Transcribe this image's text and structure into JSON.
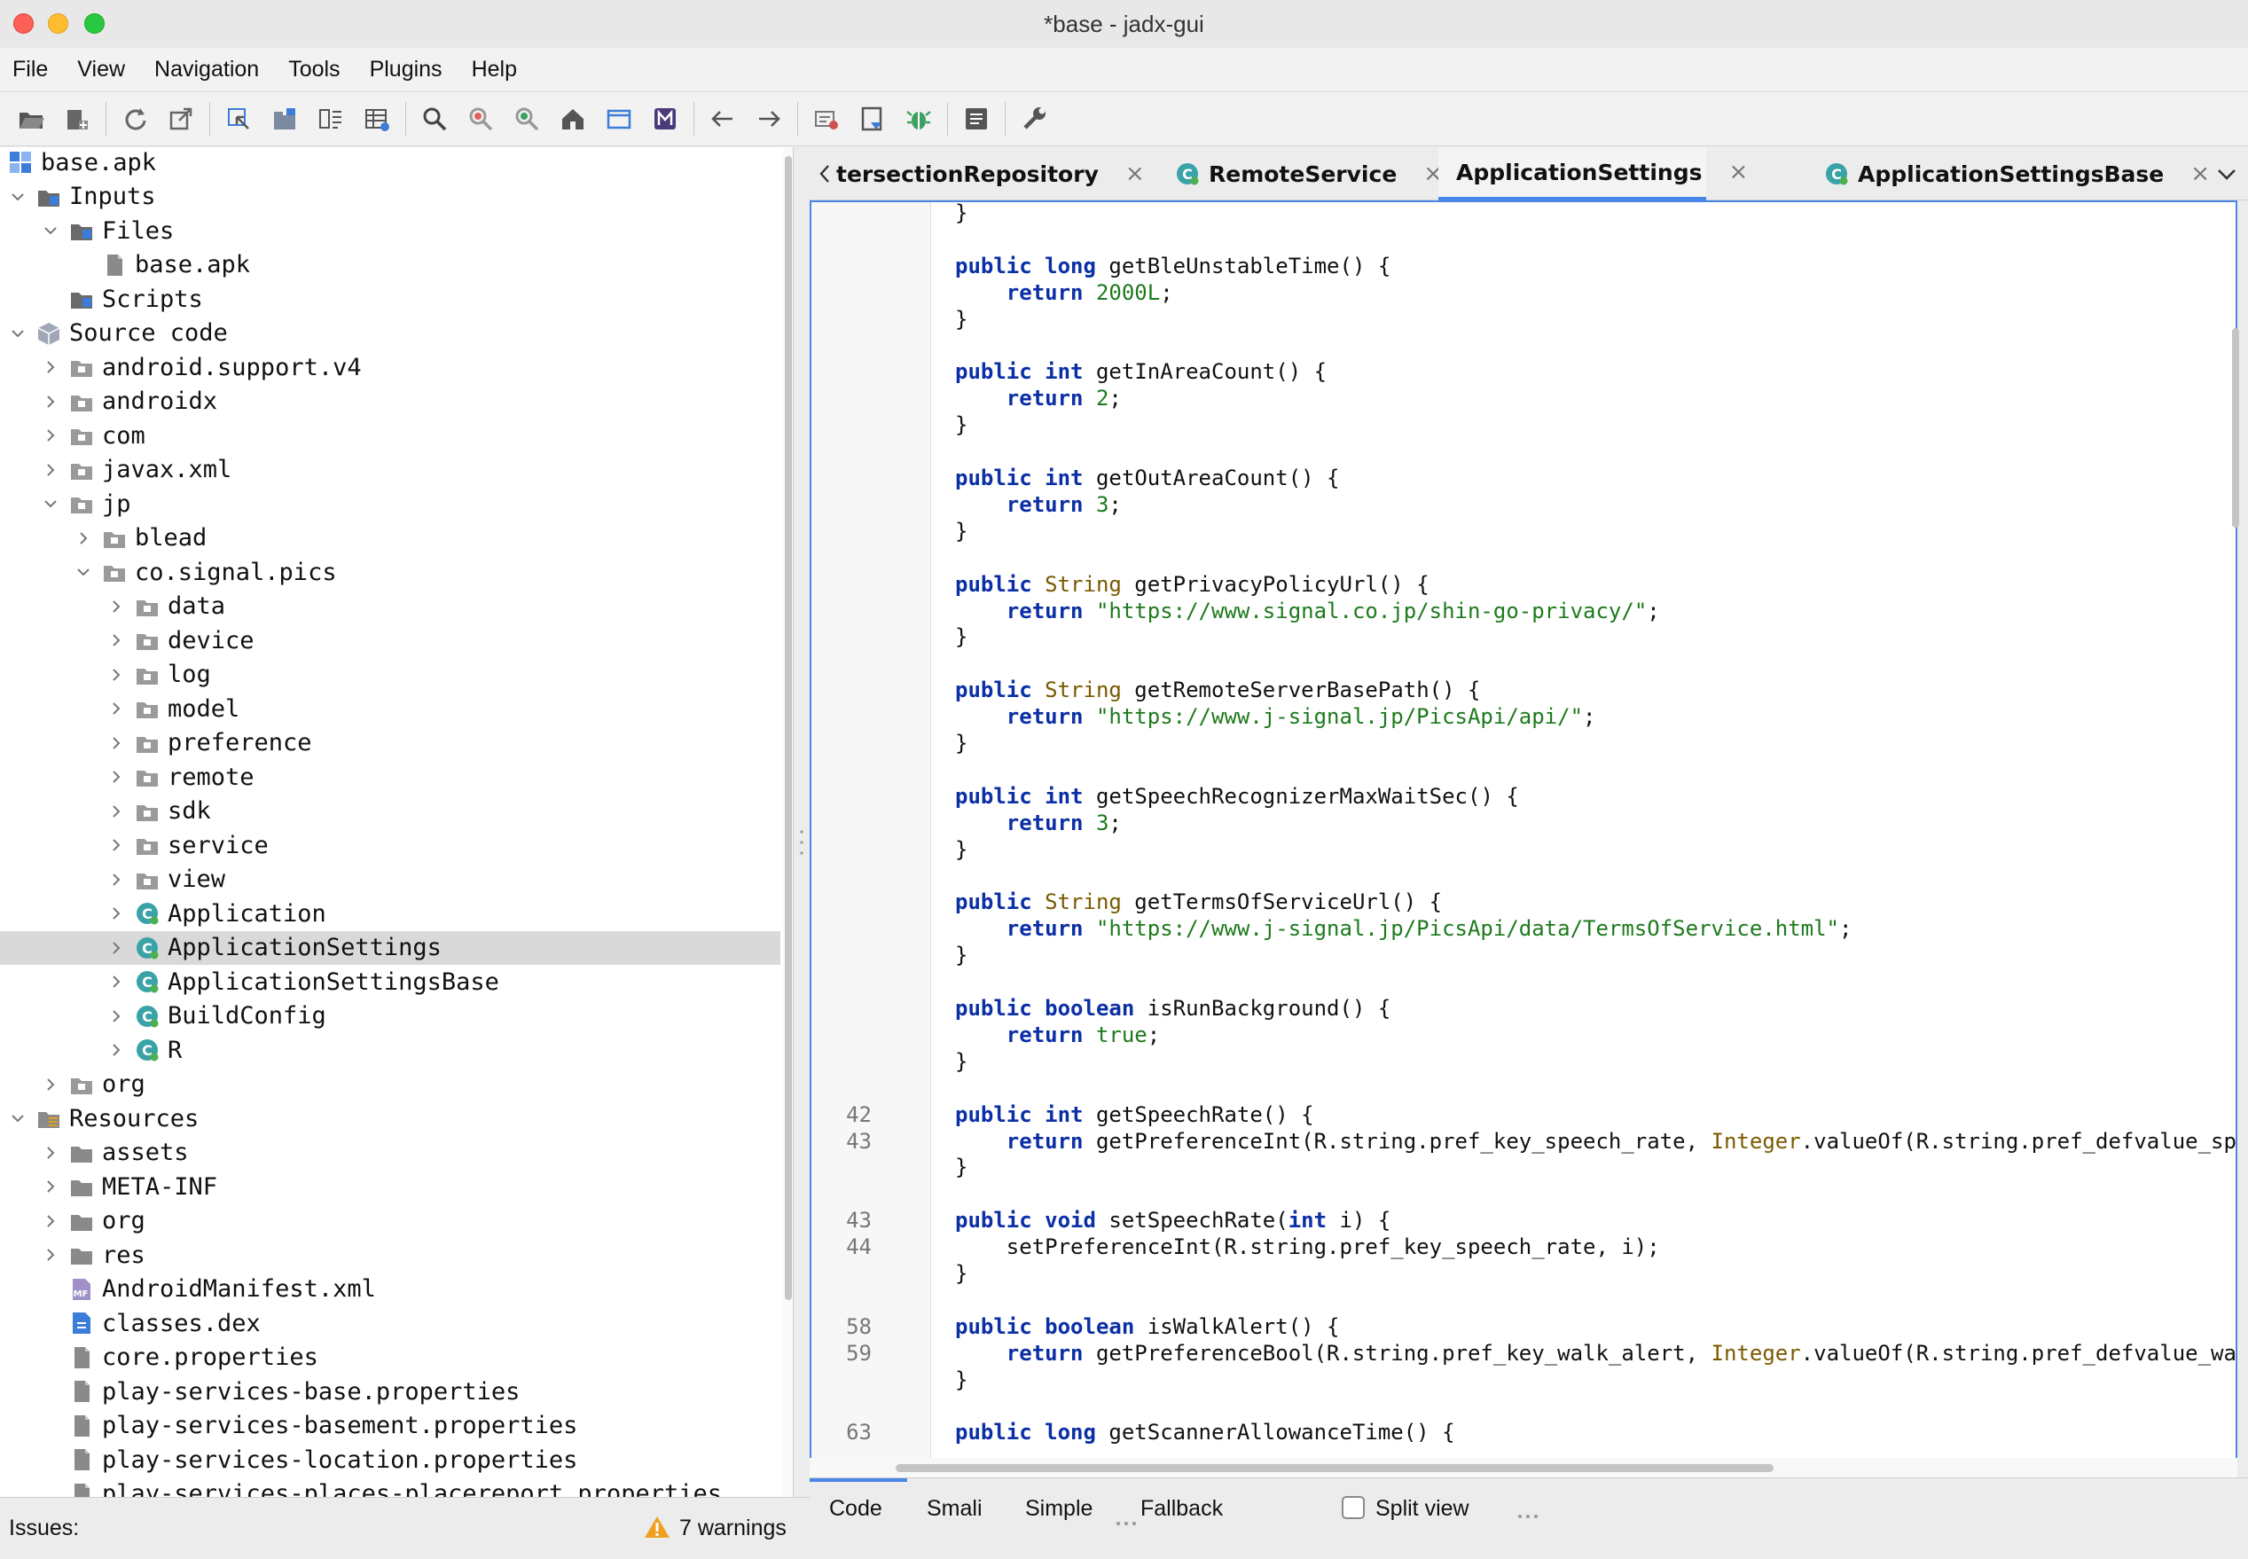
{
  "window": {
    "title": "*base - jadx-gui"
  },
  "menu": [
    "File",
    "View",
    "Navigation",
    "Tools",
    "Plugins",
    "Help"
  ],
  "toolbar": {
    "icons": [
      "open-file-icon",
      "add-files-icon",
      "reload-icon",
      "export-icon",
      "sync-tree-icon",
      "flatten-packages-icon",
      "quark-icon",
      "table-icon",
      "search-icon",
      "find-usage-icon",
      "search-text-icon",
      "home-icon",
      "window-icon",
      "mapping-icon",
      "back-icon",
      "forward-icon",
      "deobfuscate-icon",
      "bookmark-icon",
      "debug-icon",
      "log-icon",
      "settings-icon"
    ]
  },
  "tree": [
    {
      "label": "base.apk",
      "depth": 0,
      "chevron": "none",
      "icon": "apk"
    },
    {
      "label": "Inputs",
      "depth": 0,
      "chevron": "down",
      "icon": "folder-dark"
    },
    {
      "label": "Files",
      "depth": 1,
      "chevron": "down",
      "icon": "folder-dark"
    },
    {
      "label": "base.apk",
      "depth": 2,
      "chevron": "none",
      "icon": "file"
    },
    {
      "label": "Scripts",
      "depth": 1,
      "chevron": "none",
      "icon": "folder-dark"
    },
    {
      "label": "Source code",
      "depth": 0,
      "chevron": "down",
      "icon": "box"
    },
    {
      "label": "android.support.v4",
      "depth": 1,
      "chevron": "right",
      "icon": "package"
    },
    {
      "label": "androidx",
      "depth": 1,
      "chevron": "right",
      "icon": "package"
    },
    {
      "label": "com",
      "depth": 1,
      "chevron": "right",
      "icon": "package"
    },
    {
      "label": "javax.xml",
      "depth": 1,
      "chevron": "right",
      "icon": "package"
    },
    {
      "label": "jp",
      "depth": 1,
      "chevron": "down",
      "icon": "package"
    },
    {
      "label": "blead",
      "depth": 2,
      "chevron": "right",
      "icon": "package"
    },
    {
      "label": "co.signal.pics",
      "depth": 2,
      "chevron": "down",
      "icon": "package"
    },
    {
      "label": "data",
      "depth": 3,
      "chevron": "right",
      "icon": "package"
    },
    {
      "label": "device",
      "depth": 3,
      "chevron": "right",
      "icon": "package"
    },
    {
      "label": "log",
      "depth": 3,
      "chevron": "right",
      "icon": "package"
    },
    {
      "label": "model",
      "depth": 3,
      "chevron": "right",
      "icon": "package"
    },
    {
      "label": "preference",
      "depth": 3,
      "chevron": "right",
      "icon": "package"
    },
    {
      "label": "remote",
      "depth": 3,
      "chevron": "right",
      "icon": "package"
    },
    {
      "label": "sdk",
      "depth": 3,
      "chevron": "right",
      "icon": "package"
    },
    {
      "label": "service",
      "depth": 3,
      "chevron": "right",
      "icon": "package"
    },
    {
      "label": "view",
      "depth": 3,
      "chevron": "right",
      "icon": "package"
    },
    {
      "label": "Application",
      "depth": 3,
      "chevron": "right",
      "icon": "class"
    },
    {
      "label": "ApplicationSettings",
      "depth": 3,
      "chevron": "right",
      "icon": "class",
      "selected": true
    },
    {
      "label": "ApplicationSettingsBase",
      "depth": 3,
      "chevron": "right",
      "icon": "class"
    },
    {
      "label": "BuildConfig",
      "depth": 3,
      "chevron": "right",
      "icon": "class"
    },
    {
      "label": "R",
      "depth": 3,
      "chevron": "right",
      "icon": "class"
    },
    {
      "label": "org",
      "depth": 1,
      "chevron": "right",
      "icon": "package"
    },
    {
      "label": "Resources",
      "depth": 0,
      "chevron": "down",
      "icon": "resources"
    },
    {
      "label": "assets",
      "depth": 1,
      "chevron": "right",
      "icon": "folder"
    },
    {
      "label": "META-INF",
      "depth": 1,
      "chevron": "right",
      "icon": "folder"
    },
    {
      "label": "org",
      "depth": 1,
      "chevron": "right",
      "icon": "folder"
    },
    {
      "label": "res",
      "depth": 1,
      "chevron": "right",
      "icon": "folder"
    },
    {
      "label": "AndroidManifest.xml",
      "depth": 1,
      "chevron": "none",
      "icon": "manifest"
    },
    {
      "label": "classes.dex",
      "depth": 1,
      "chevron": "none",
      "icon": "dex"
    },
    {
      "label": "core.properties",
      "depth": 1,
      "chevron": "none",
      "icon": "file"
    },
    {
      "label": "play-services-base.properties",
      "depth": 1,
      "chevron": "none",
      "icon": "file"
    },
    {
      "label": "play-services-basement.properties",
      "depth": 1,
      "chevron": "none",
      "icon": "file"
    },
    {
      "label": "play-services-location.properties",
      "depth": 1,
      "chevron": "none",
      "icon": "file"
    },
    {
      "label": "play-services-places-placereport.properties",
      "depth": 1,
      "chevron": "none",
      "icon": "file"
    }
  ],
  "tabs": [
    {
      "label": "tersectionRepository",
      "icon": false,
      "active": false
    },
    {
      "label": "RemoteService",
      "icon": true,
      "active": false
    },
    {
      "label": "ApplicationSettings",
      "icon": true,
      "active": true
    },
    {
      "label": "ApplicationSettingsBase",
      "icon": true,
      "active": false
    }
  ],
  "tab_close_glyph": "×",
  "code": [
    {
      "ln": "",
      "tokens": [
        [
          "p",
          "}"
        ]
      ]
    },
    {
      "ln": "",
      "tokens": []
    },
    {
      "ln": "",
      "tokens": [
        [
          "k",
          "public"
        ],
        [
          "p",
          " "
        ],
        [
          "k",
          "long"
        ],
        [
          "p",
          " getBleUnstableTime() {"
        ]
      ]
    },
    {
      "ln": "",
      "tokens": [
        [
          "p",
          "    "
        ],
        [
          "k",
          "return"
        ],
        [
          "p",
          " "
        ],
        [
          "n",
          "2000L"
        ],
        [
          "p",
          ";"
        ]
      ]
    },
    {
      "ln": "",
      "tokens": [
        [
          "p",
          "}"
        ]
      ]
    },
    {
      "ln": "",
      "tokens": []
    },
    {
      "ln": "",
      "tokens": [
        [
          "k",
          "public"
        ],
        [
          "p",
          " "
        ],
        [
          "k",
          "int"
        ],
        [
          "p",
          " getInAreaCount() {"
        ]
      ]
    },
    {
      "ln": "",
      "tokens": [
        [
          "p",
          "    "
        ],
        [
          "k",
          "return"
        ],
        [
          "p",
          " "
        ],
        [
          "n",
          "2"
        ],
        [
          "p",
          ";"
        ]
      ]
    },
    {
      "ln": "",
      "tokens": [
        [
          "p",
          "}"
        ]
      ]
    },
    {
      "ln": "",
      "tokens": []
    },
    {
      "ln": "",
      "tokens": [
        [
          "k",
          "public"
        ],
        [
          "p",
          " "
        ],
        [
          "k",
          "int"
        ],
        [
          "p",
          " getOutAreaCount() {"
        ]
      ]
    },
    {
      "ln": "",
      "tokens": [
        [
          "p",
          "    "
        ],
        [
          "k",
          "return"
        ],
        [
          "p",
          " "
        ],
        [
          "n",
          "3"
        ],
        [
          "p",
          ";"
        ]
      ]
    },
    {
      "ln": "",
      "tokens": [
        [
          "p",
          "}"
        ]
      ]
    },
    {
      "ln": "",
      "tokens": []
    },
    {
      "ln": "",
      "tokens": [
        [
          "k",
          "public"
        ],
        [
          "p",
          " "
        ],
        [
          "t",
          "String"
        ],
        [
          "p",
          " getPrivacyPolicyUrl() {"
        ]
      ]
    },
    {
      "ln": "",
      "tokens": [
        [
          "p",
          "    "
        ],
        [
          "k",
          "return"
        ],
        [
          "p",
          " "
        ],
        [
          "s",
          "\"https://www.signal.co.jp/shin-go-privacy/\""
        ],
        [
          "p",
          ";"
        ]
      ]
    },
    {
      "ln": "",
      "tokens": [
        [
          "p",
          "}"
        ]
      ]
    },
    {
      "ln": "",
      "tokens": []
    },
    {
      "ln": "",
      "tokens": [
        [
          "k",
          "public"
        ],
        [
          "p",
          " "
        ],
        [
          "t",
          "String"
        ],
        [
          "p",
          " getRemoteServerBasePath() {"
        ]
      ]
    },
    {
      "ln": "",
      "tokens": [
        [
          "p",
          "    "
        ],
        [
          "k",
          "return"
        ],
        [
          "p",
          " "
        ],
        [
          "s",
          "\"https://www.j-signal.jp/PicsApi/api/\""
        ],
        [
          "p",
          ";"
        ]
      ]
    },
    {
      "ln": "",
      "tokens": [
        [
          "p",
          "}"
        ]
      ]
    },
    {
      "ln": "",
      "tokens": []
    },
    {
      "ln": "",
      "tokens": [
        [
          "k",
          "public"
        ],
        [
          "p",
          " "
        ],
        [
          "k",
          "int"
        ],
        [
          "p",
          " getSpeechRecognizerMaxWaitSec() {"
        ]
      ]
    },
    {
      "ln": "",
      "tokens": [
        [
          "p",
          "    "
        ],
        [
          "k",
          "return"
        ],
        [
          "p",
          " "
        ],
        [
          "n",
          "3"
        ],
        [
          "p",
          ";"
        ]
      ]
    },
    {
      "ln": "",
      "tokens": [
        [
          "p",
          "}"
        ]
      ]
    },
    {
      "ln": "",
      "tokens": []
    },
    {
      "ln": "",
      "tokens": [
        [
          "k",
          "public"
        ],
        [
          "p",
          " "
        ],
        [
          "t",
          "String"
        ],
        [
          "p",
          " getTermsOfServiceUrl() {"
        ]
      ]
    },
    {
      "ln": "",
      "tokens": [
        [
          "p",
          "    "
        ],
        [
          "k",
          "return"
        ],
        [
          "p",
          " "
        ],
        [
          "s",
          "\"https://www.j-signal.jp/PicsApi/data/TermsOfService.html\""
        ],
        [
          "p",
          ";"
        ]
      ]
    },
    {
      "ln": "",
      "tokens": [
        [
          "p",
          "}"
        ]
      ]
    },
    {
      "ln": "",
      "tokens": []
    },
    {
      "ln": "",
      "tokens": [
        [
          "k",
          "public"
        ],
        [
          "p",
          " "
        ],
        [
          "k",
          "boolean"
        ],
        [
          "p",
          " isRunBackground() {"
        ]
      ]
    },
    {
      "ln": "",
      "tokens": [
        [
          "p",
          "    "
        ],
        [
          "k",
          "return"
        ],
        [
          "p",
          " "
        ],
        [
          "n",
          "true"
        ],
        [
          "p",
          ";"
        ]
      ]
    },
    {
      "ln": "",
      "tokens": [
        [
          "p",
          "}"
        ]
      ]
    },
    {
      "ln": "",
      "tokens": []
    },
    {
      "ln": "42",
      "tokens": [
        [
          "k",
          "public"
        ],
        [
          "p",
          " "
        ],
        [
          "k",
          "int"
        ],
        [
          "p",
          " getSpeechRate() {"
        ]
      ]
    },
    {
      "ln": "43",
      "tokens": [
        [
          "p",
          "    "
        ],
        [
          "k",
          "return"
        ],
        [
          "p",
          " getPreferenceInt(R.string.pref_key_speech_rate, "
        ],
        [
          "t",
          "Integer"
        ],
        [
          "p",
          ".valueOf(R.string.pref_defvalue_speec"
        ]
      ]
    },
    {
      "ln": "",
      "tokens": [
        [
          "p",
          "}"
        ]
      ]
    },
    {
      "ln": "",
      "tokens": []
    },
    {
      "ln": "43",
      "tokens": [
        [
          "k",
          "public"
        ],
        [
          "p",
          " "
        ],
        [
          "k",
          "void"
        ],
        [
          "p",
          " setSpeechRate("
        ],
        [
          "k",
          "int"
        ],
        [
          "p",
          " i) {"
        ]
      ]
    },
    {
      "ln": "44",
      "tokens": [
        [
          "p",
          "    setPreferenceInt(R.string.pref_key_speech_rate, i);"
        ]
      ]
    },
    {
      "ln": "",
      "tokens": [
        [
          "p",
          "}"
        ]
      ]
    },
    {
      "ln": "",
      "tokens": []
    },
    {
      "ln": "58",
      "tokens": [
        [
          "k",
          "public"
        ],
        [
          "p",
          " "
        ],
        [
          "k",
          "boolean"
        ],
        [
          "p",
          " isWalkAlert() {"
        ]
      ]
    },
    {
      "ln": "59",
      "tokens": [
        [
          "p",
          "    "
        ],
        [
          "k",
          "return"
        ],
        [
          "p",
          " getPreferenceBool(R.string.pref_key_walk_alert, "
        ],
        [
          "t",
          "Integer"
        ],
        [
          "p",
          ".valueOf(R.string.pref_defvalue_walk_"
        ]
      ]
    },
    {
      "ln": "",
      "tokens": [
        [
          "p",
          "}"
        ]
      ]
    },
    {
      "ln": "",
      "tokens": []
    },
    {
      "ln": "63",
      "tokens": [
        [
          "k",
          "public"
        ],
        [
          "p",
          " "
        ],
        [
          "k",
          "long"
        ],
        [
          "p",
          " getScannerAllowanceTime() {"
        ]
      ]
    }
  ],
  "bottom_tabs": [
    "Code",
    "Smali",
    "Simple",
    "Fallback"
  ],
  "split_view": {
    "label": "Split view",
    "checked": false
  },
  "status": {
    "issues_label": "Issues:",
    "warnings": "7 warnings"
  },
  "colors": {
    "accent": "#4a86e8",
    "keyword": "#0b2fa5",
    "string": "#1d7a1d",
    "type": "#7a5a00",
    "class_icon": "#3aa3a8"
  }
}
